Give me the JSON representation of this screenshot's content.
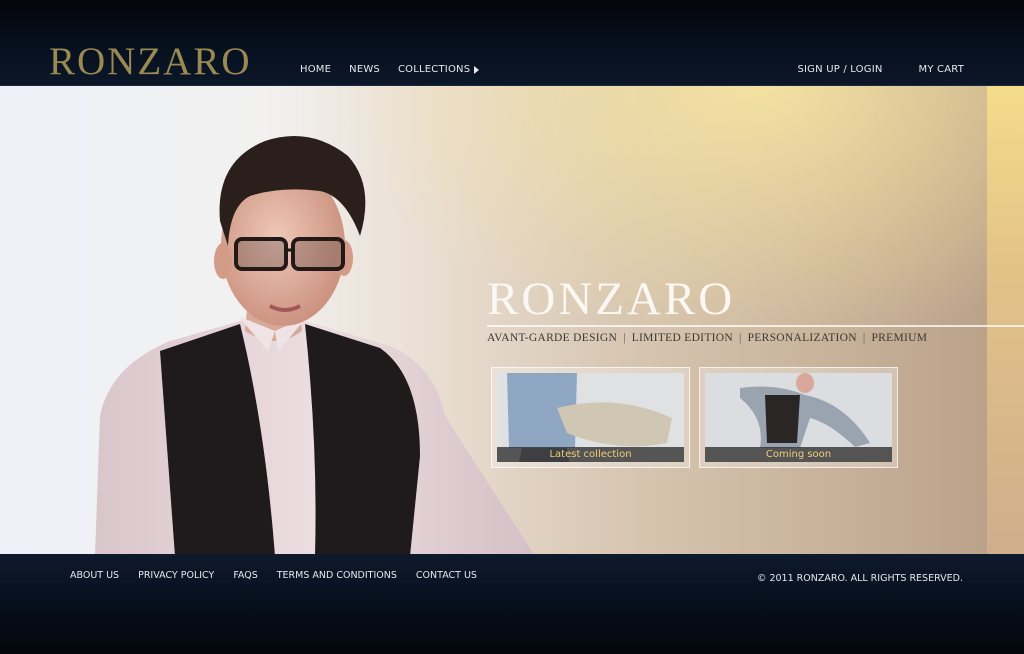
{
  "header": {
    "logo": "RONZARO",
    "nav": [
      {
        "label": "HOME"
      },
      {
        "label": "NEWS"
      },
      {
        "label": "COLLECTIONS"
      }
    ],
    "account": {
      "signup_login": "SIGN UP / LOGIN",
      "cart": "MY CART"
    }
  },
  "hero": {
    "brand": "RONZARO",
    "tagline": [
      "AVANT-GARDE DESIGN",
      "LIMITED EDITION",
      "PERSONALIZATION",
      "PREMIUM"
    ],
    "tagline_separator": "|",
    "thumbs": [
      {
        "caption": "Latest collection"
      },
      {
        "caption": "Coming soon"
      }
    ]
  },
  "footer": {
    "links": [
      "ABOUT US",
      "PRIVACY POLICY",
      "FAQS",
      "TERMS AND CONDITIONS",
      "CONTACT US"
    ],
    "copyright": "© 2011 RONZARO. ALL RIGHTS RESERVED."
  },
  "colors": {
    "header_bg": "#07101e",
    "logo_gold": "#9a8a52",
    "caption_gold": "#f1cf77",
    "strip_gold": "#f3dc8a"
  }
}
